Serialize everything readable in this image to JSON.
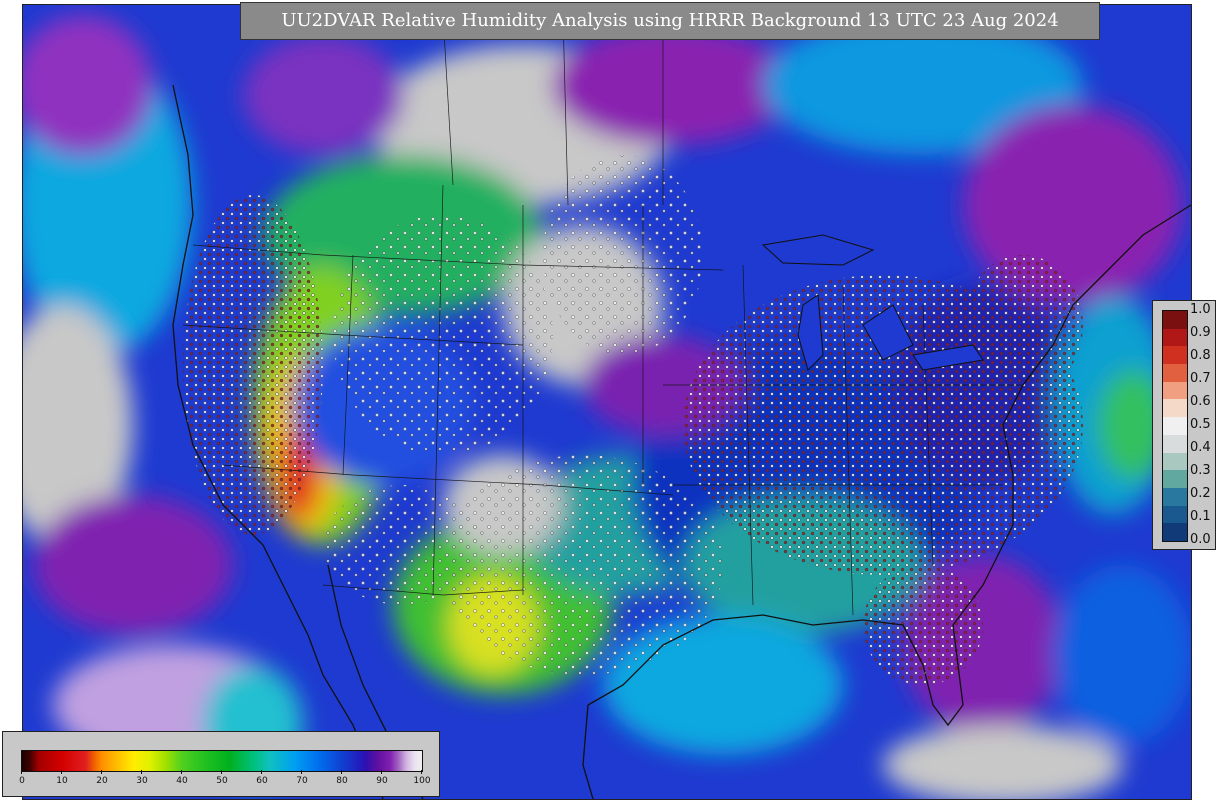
{
  "title": "UU2DVAR Relative Humidity Analysis using HRRR Background 13 UTC 23 Aug 2024",
  "colorbar_bottom": {
    "labels": [
      "0",
      "10",
      "20",
      "30",
      "40",
      "50",
      "60",
      "70",
      "80",
      "90",
      "100"
    ]
  },
  "colorbar_right": {
    "labels": [
      "1.0",
      "0.9",
      "0.8",
      "0.7",
      "0.6",
      "0.5",
      "0.4",
      "0.3",
      "0.2",
      "0.1",
      "0.0"
    ],
    "colors": [
      "#7a1010",
      "#b01818",
      "#d03020",
      "#e06040",
      "#f0a080",
      "#f4d8c8",
      "#f0f0f0",
      "#d8dcdc",
      "#a8c8c0",
      "#60a8a0",
      "#2878a0",
      "#1a5890",
      "#103a78"
    ]
  },
  "colors": {
    "ocean_blue": "#1e3ad0",
    "dry_red": "#d81818",
    "moist_gray": "#c8c8c8",
    "purple": "#8a20b0",
    "green": "#20c020",
    "yellow": "#f0e000",
    "cyan": "#10b0d0"
  }
}
